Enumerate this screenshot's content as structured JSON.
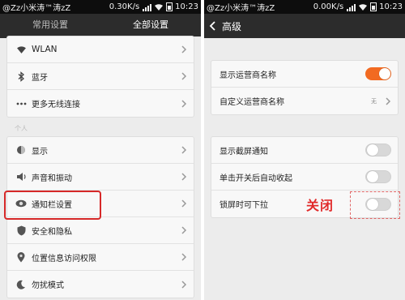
{
  "left": {
    "status": {
      "carrier": "@Zz小米涛™涛zZ",
      "speed": "0.30K/s",
      "time": "10:23"
    },
    "tabs": [
      {
        "label": "常用设置",
        "active": false
      },
      {
        "label": "全部设置",
        "active": true
      }
    ],
    "wireless_items": [
      {
        "label": "WLAN",
        "icon": "wifi-icon"
      },
      {
        "label": "蓝牙",
        "icon": "bluetooth-icon"
      },
      {
        "label": "更多无线连接",
        "icon": "more-dots-icon"
      }
    ],
    "section_personal": "个人",
    "personal_items": [
      {
        "label": "显示",
        "icon": "display-icon"
      },
      {
        "label": "声音和振动",
        "icon": "sound-icon"
      },
      {
        "label": "通知栏设置",
        "icon": "eye-icon"
      },
      {
        "label": "安全和隐私",
        "icon": "shield-icon"
      },
      {
        "label": "位置信息访问权限",
        "icon": "location-pin-icon"
      },
      {
        "label": "勿扰模式",
        "icon": "moon-icon"
      }
    ]
  },
  "right": {
    "status": {
      "carrier": "@Zz小米涛™涛zZ",
      "speed": "0.00K/s",
      "time": "10:23"
    },
    "title": "高级",
    "carrier_items": [
      {
        "label": "显示运营商名称",
        "control": "toggle",
        "on": true
      },
      {
        "label": "自定义运营商名称",
        "control": "value",
        "value": "无"
      }
    ],
    "other_items": [
      {
        "label": "显示截屏通知",
        "on": false
      },
      {
        "label": "单击开关后自动收起",
        "on": false
      },
      {
        "label": "锁屏时可下拉",
        "on": false
      }
    ],
    "annotation": "关闭"
  },
  "colors": {
    "accent_orange": "#f26a21",
    "annotation_red": "#e12a2a",
    "bar_dark": "#2c2c2c"
  }
}
